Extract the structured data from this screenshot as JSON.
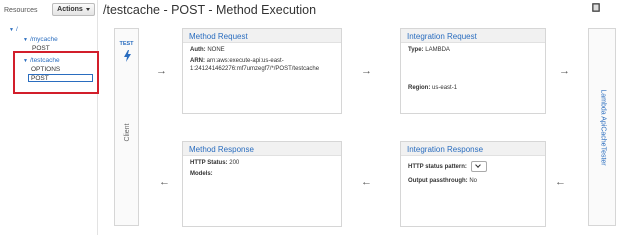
{
  "sidebar": {
    "resources_label": "Resources",
    "actions_label": "Actions",
    "tree": [
      {
        "label": "/"
      },
      {
        "label": "/mycache"
      },
      {
        "label": "POST"
      },
      {
        "label": "/testcache"
      },
      {
        "label": "OPTIONS"
      },
      {
        "label": "POST"
      }
    ]
  },
  "header": {
    "title": "/testcache - POST - Method Execution"
  },
  "test": {
    "label": "TEST",
    "client_label": "Client"
  },
  "lambda": {
    "label": "Lambda ApiCacheTester"
  },
  "method_request": {
    "title": "Method Request",
    "auth_label": "Auth:",
    "auth_value": "NONE",
    "arn_label": "ARN:",
    "arn_line1": "arn:aws:execute-api:us-east-",
    "arn_line2": "1:241241462276:mf7umzegf7/*/POST/testcache"
  },
  "integration_request": {
    "title": "Integration Request",
    "type_label": "Type:",
    "type_value": "LAMBDA",
    "region_label": "Region:",
    "region_value": "us-east-1"
  },
  "method_response": {
    "title": "Method Response",
    "status_label": "HTTP Status:",
    "status_value": "200",
    "models_label": "Models:"
  },
  "integration_response": {
    "title": "Integration Response",
    "pattern_label": "HTTP status pattern:",
    "passthrough_label": "Output passthrough:",
    "passthrough_value": "No"
  },
  "arrows": {
    "right": "→",
    "left": "←"
  }
}
